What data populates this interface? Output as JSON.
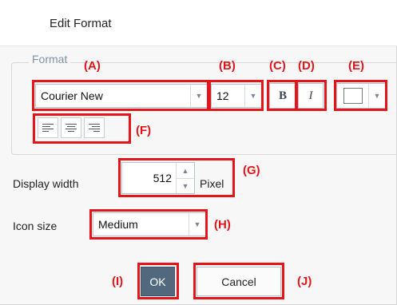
{
  "dialog": {
    "title": "Edit Format"
  },
  "format_group": {
    "legend": "Format",
    "font": {
      "value": "Courier New"
    },
    "size": {
      "value": "12"
    },
    "bold_label": "B",
    "italic_label": "I",
    "color": {
      "value": "#ffffff"
    },
    "alignment": [
      "align-left",
      "align-center",
      "align-right"
    ]
  },
  "display_width": {
    "label": "Display width",
    "value": "512",
    "unit": "Pixel"
  },
  "icon_size": {
    "label": "Icon size",
    "value": "Medium"
  },
  "buttons": {
    "ok": "OK",
    "cancel": "Cancel"
  },
  "callouts": {
    "A": "(A)",
    "B": "(B)",
    "C": "(C)",
    "D": "(D)",
    "E": "(E)",
    "F": "(F)",
    "G": "(G)",
    "H": "(H)",
    "I": "(I)",
    "J": "(J)"
  },
  "colors": {
    "callout": "#e3151a",
    "ok_button": "#52697d",
    "legend": "#7f93a8"
  },
  "icons": {
    "dropdown": "chevron-down-icon",
    "spin_up": "chevron-up-icon",
    "spin_down": "chevron-down-icon",
    "align": [
      "align-left-icon",
      "align-center-icon",
      "align-right-icon"
    ]
  }
}
